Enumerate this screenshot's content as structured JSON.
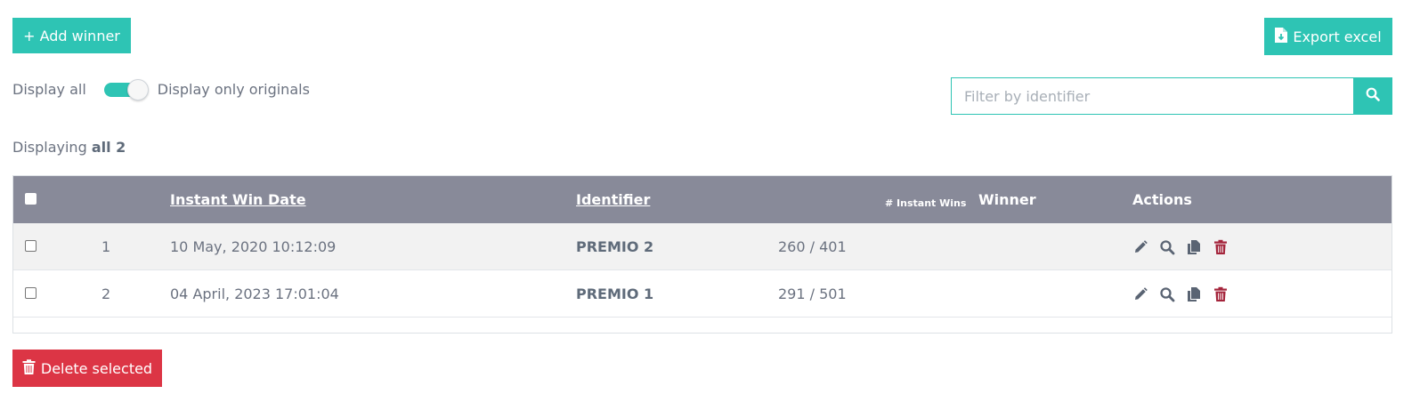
{
  "toolbar": {
    "add_winner_label": "+ Add winner",
    "export_label": "Export excel",
    "delete_selected_label": "Delete selected"
  },
  "filter": {
    "display_all_label": "Display all",
    "display_originals_label": "Display only originals",
    "originals_toggle_on": true,
    "search_placeholder": "Filter by identifier",
    "search_value": ""
  },
  "summary": {
    "prefix": "Displaying",
    "value": "all 2"
  },
  "table": {
    "columns": {
      "date": "Instant Win Date",
      "identifier": "Identifier",
      "instant_wins": "# Instant Wins",
      "winner": "Winner",
      "actions": "Actions"
    },
    "rows": [
      {
        "index": "1",
        "date": "10 May, 2020 10:12:09",
        "identifier": "PREMIO 2",
        "instant_wins": "260 / 401",
        "winner": ""
      },
      {
        "index": "2",
        "date": "04 April, 2023 17:01:04",
        "identifier": "PREMIO 1",
        "instant_wins": "291 / 501",
        "winner": ""
      }
    ]
  },
  "icons": {
    "edit": "pencil-icon",
    "view": "search-icon",
    "duplicate": "copy-icon",
    "delete": "trash-icon",
    "export": "file-download-icon",
    "search": "search-icon"
  },
  "colors": {
    "primary": "#2ec4b4",
    "danger": "#dc3545",
    "header": "#888a99",
    "delete_icon": "#a4243b",
    "action_icon": "#5a6473"
  }
}
